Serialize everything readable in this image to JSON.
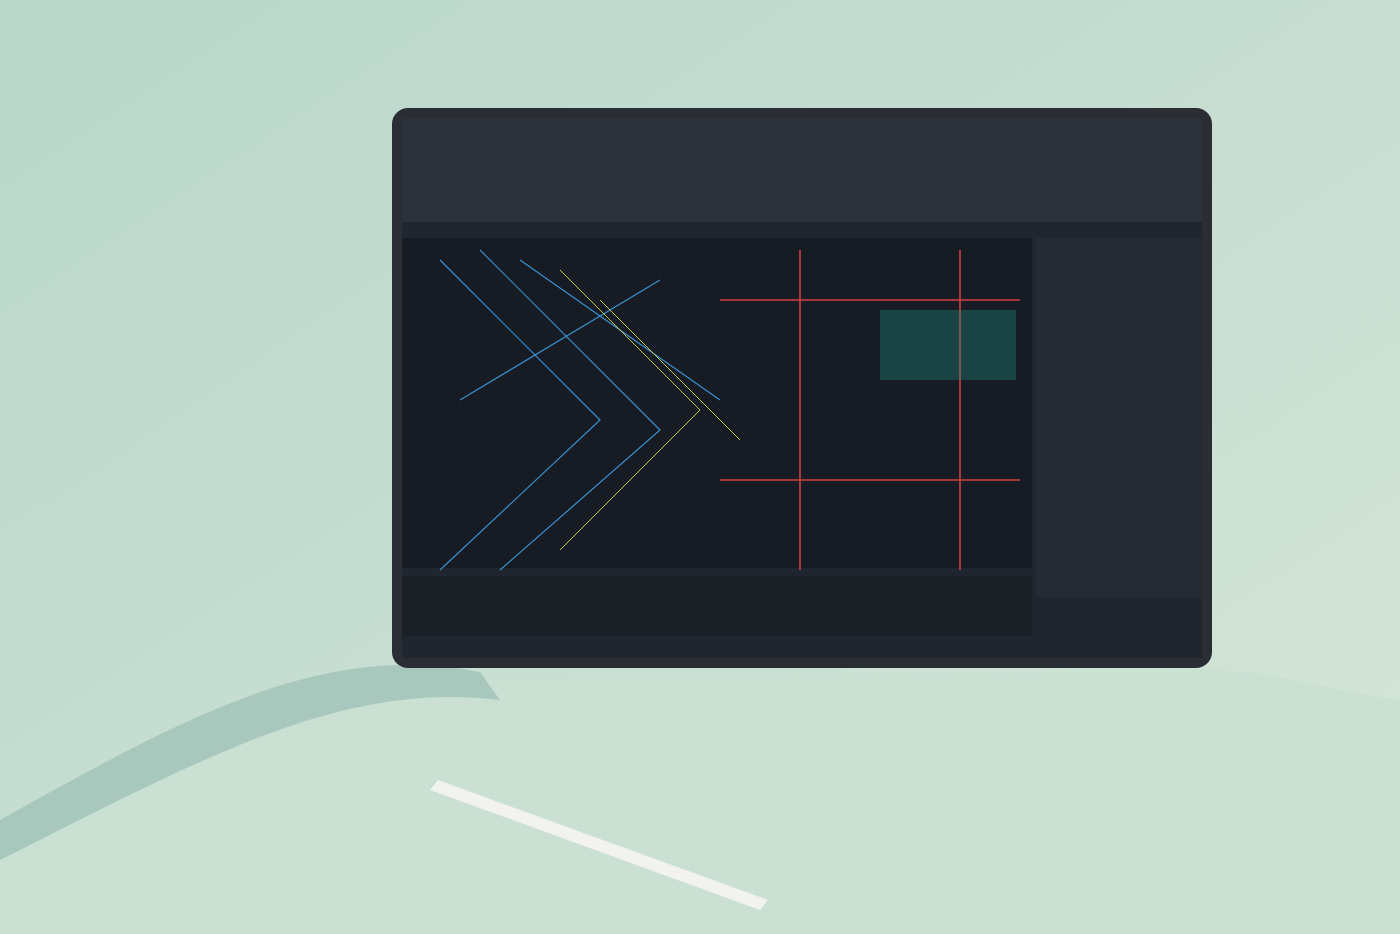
{
  "photo": {
    "kind": "tablet-on-desk"
  }
}
